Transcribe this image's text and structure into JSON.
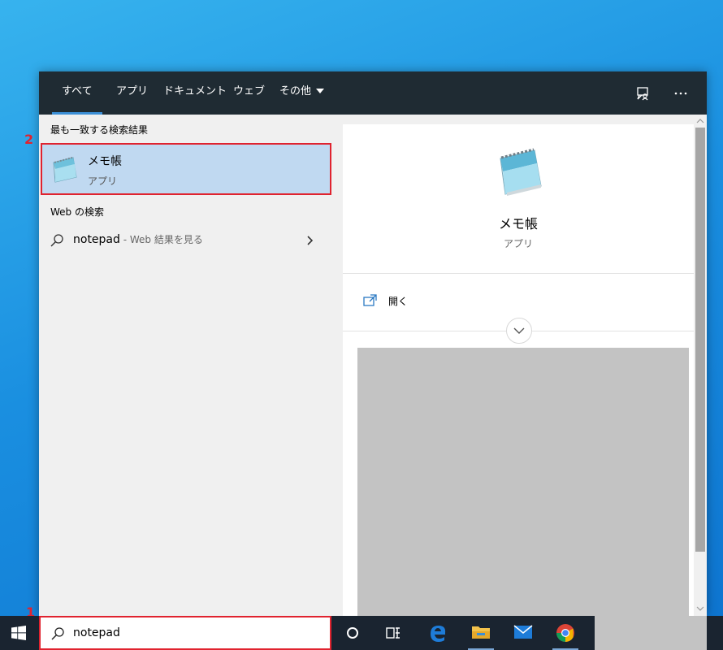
{
  "nav": {
    "tabs": [
      "すべて",
      "アプリ",
      "ドキュメント",
      "ウェブ",
      "その他"
    ],
    "active_tab": "すべて",
    "icons": [
      "feedback-icon",
      "more-icon"
    ]
  },
  "results": {
    "best_match_title": "最も一致する検索結果",
    "best_match": {
      "name": "メモ帳",
      "type": "アプリ",
      "icon": "notepad-icon"
    },
    "web_title": "Web の検索",
    "web_item": {
      "query": "notepad",
      "suffix": " - Web 結果を見る"
    }
  },
  "preview": {
    "name": "メモ帳",
    "type": "アプリ",
    "open_label": "開く"
  },
  "taskbar": {
    "search_value": "notepad",
    "icons": [
      "windows-start-icon",
      "cortana-icon",
      "task-view-icon",
      "edge-icon",
      "file-explorer-icon",
      "mail-icon",
      "chrome-icon"
    ]
  },
  "annotations": {
    "step1": "1",
    "step2": "2"
  },
  "colors": {
    "highlight": "#e0232f",
    "selection": "#c0d9f1",
    "nav_bg": "#1f2b33",
    "taskbar_bg": "#1a2430"
  }
}
